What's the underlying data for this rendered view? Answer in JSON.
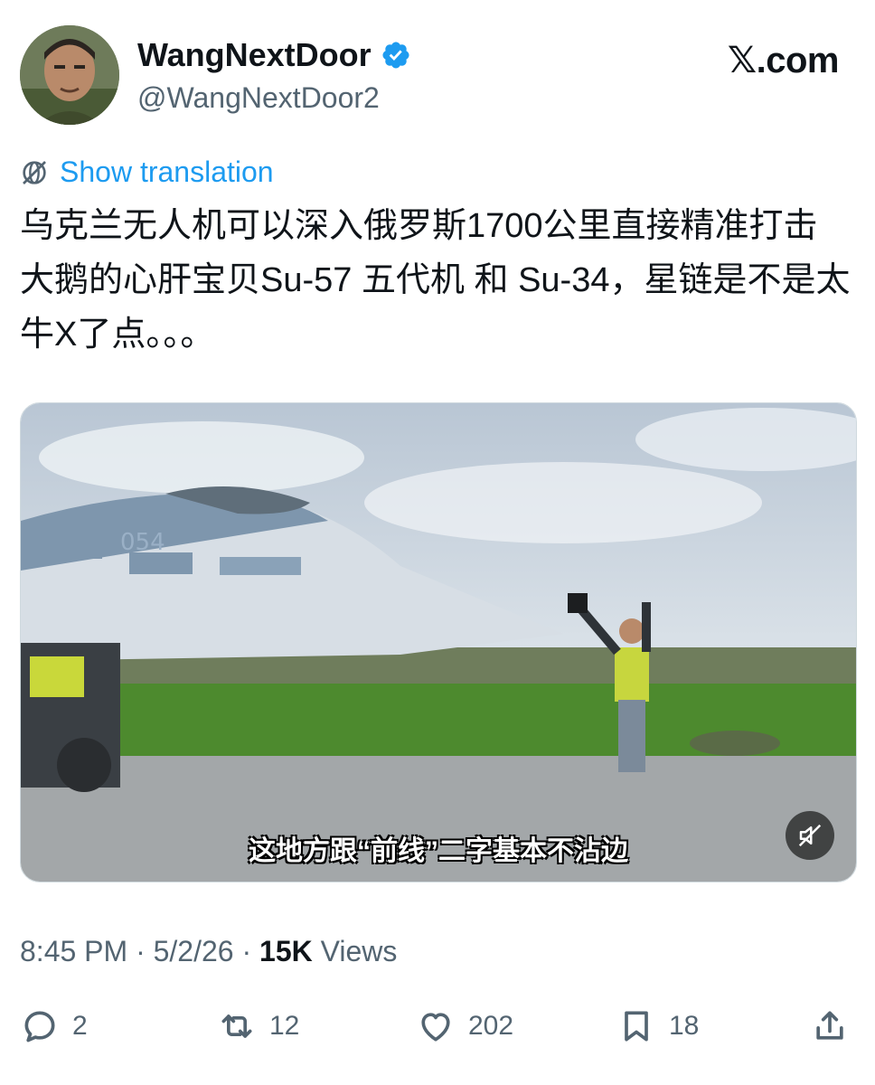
{
  "author": {
    "display_name": "WangNextDoor",
    "handle": "@WangNextDoor2",
    "verified": true
  },
  "brand": "𝕏.com",
  "translation_link": "Show translation",
  "tweet_text": "乌克兰无人机可以深入俄罗斯1700公里直接精准打击大鹅的心肝宝贝Su-57 五代机 和 Su-34，星链是不是太牛X了点。。。",
  "media": {
    "subtitle": "这地方跟“前线”二字基本不沾边",
    "aircraft_marking": "054"
  },
  "meta": {
    "time": "8:45 PM",
    "date": "5/2/26",
    "views_count": "15K",
    "views_label": "Views"
  },
  "actions": {
    "replies": "2",
    "reposts": "12",
    "likes": "202",
    "bookmarks": "18"
  },
  "colors": {
    "accent": "#1d9bf0",
    "secondary_text": "#536471",
    "primary_text": "#0f1419"
  }
}
